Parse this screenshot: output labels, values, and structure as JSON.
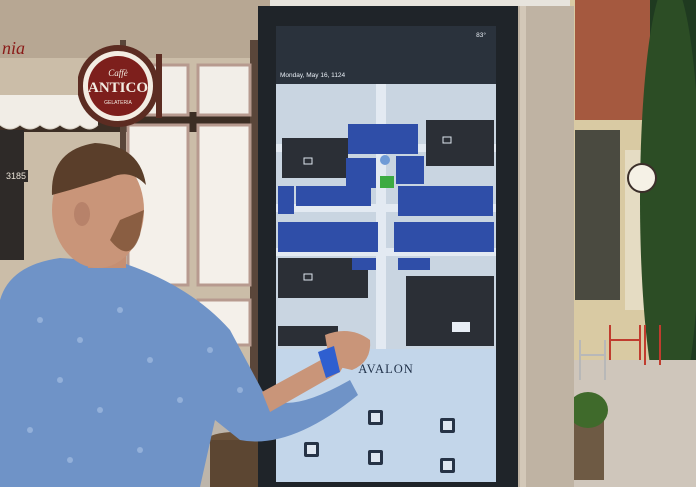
{
  "sign": {
    "cafe_top": "Caffè",
    "cafe_name": "ANTICO",
    "cafe_bottom": "GELATERIA",
    "partial_store_text": "nia",
    "address": "3185"
  },
  "kiosk": {
    "date": "Monday, May 16, 1124",
    "temperature": "83°",
    "brand": "AVALON",
    "menu_icons": [
      "dining-icon",
      "shopping-icon",
      "events-icon",
      "parking-icon",
      "directory-icon",
      "camera-icon"
    ]
  },
  "colors": {
    "map_background": "#c9d5e1",
    "map_buildings": "#2f4ea8",
    "map_dark_blocks": "#2b2f36",
    "menu_panel": "#c3d6ea",
    "kiosk_frame": "#1f2429",
    "shirt": "#6f93c7"
  }
}
